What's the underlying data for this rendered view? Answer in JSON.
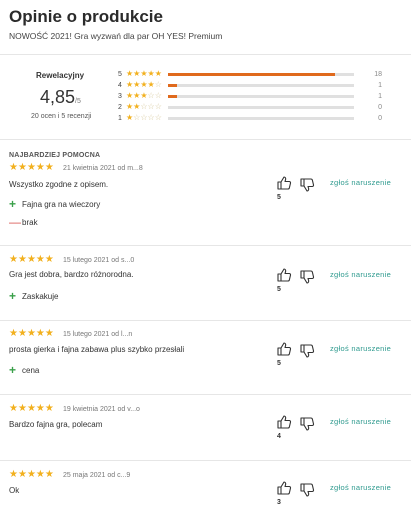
{
  "header": {
    "title": "Opinie o produkcie",
    "subtitle": "NOWOŚĆ 2021! Gra wyzwań dla par OH YES! Premium"
  },
  "summary": {
    "label": "Rewelacyjny",
    "average": "4,85",
    "scale": "/5",
    "count_text": "20 ocen i 5 recenzji"
  },
  "distribution": [
    {
      "stars": "5",
      "count": "18",
      "fraction": 0.9
    },
    {
      "stars": "4",
      "count": "1",
      "fraction": 0.05
    },
    {
      "stars": "3",
      "count": "1",
      "fraction": 0.05
    },
    {
      "stars": "2",
      "count": "0",
      "fraction": 0
    },
    {
      "stars": "1",
      "count": "0",
      "fraction": 0
    }
  ],
  "helpful_label": "NAJBARDZIEJ POMOCNA",
  "report_label": "zgłoś naruszenie",
  "reviews": [
    {
      "meta": "21 kwietnia 2021 od m...8",
      "text": "Wszystko zgodne z opisem.",
      "pros": [
        "Fajna gra na wieczory"
      ],
      "cons": [
        "brak"
      ],
      "likes": "5"
    },
    {
      "meta": "15 lutego 2021 od s...0",
      "text": "Gra jest dobra, bardzo różnorodna.",
      "pros": [
        "Zaskakuje"
      ],
      "cons": [],
      "likes": "5"
    },
    {
      "meta": "15 lutego 2021 od l...n",
      "text": "prosta gierka i fajna zabawa plus szybko przesłali",
      "pros": [
        "cena"
      ],
      "cons": [],
      "likes": "5"
    },
    {
      "meta": "19 kwietnia 2021 od v...o",
      "text": "Bardzo fajna gra, polecam",
      "pros": [],
      "cons": [],
      "likes": "4"
    },
    {
      "meta": "25 maja 2021 od c...9",
      "text": "Ok",
      "pros": [],
      "cons": [],
      "likes": "3"
    }
  ]
}
